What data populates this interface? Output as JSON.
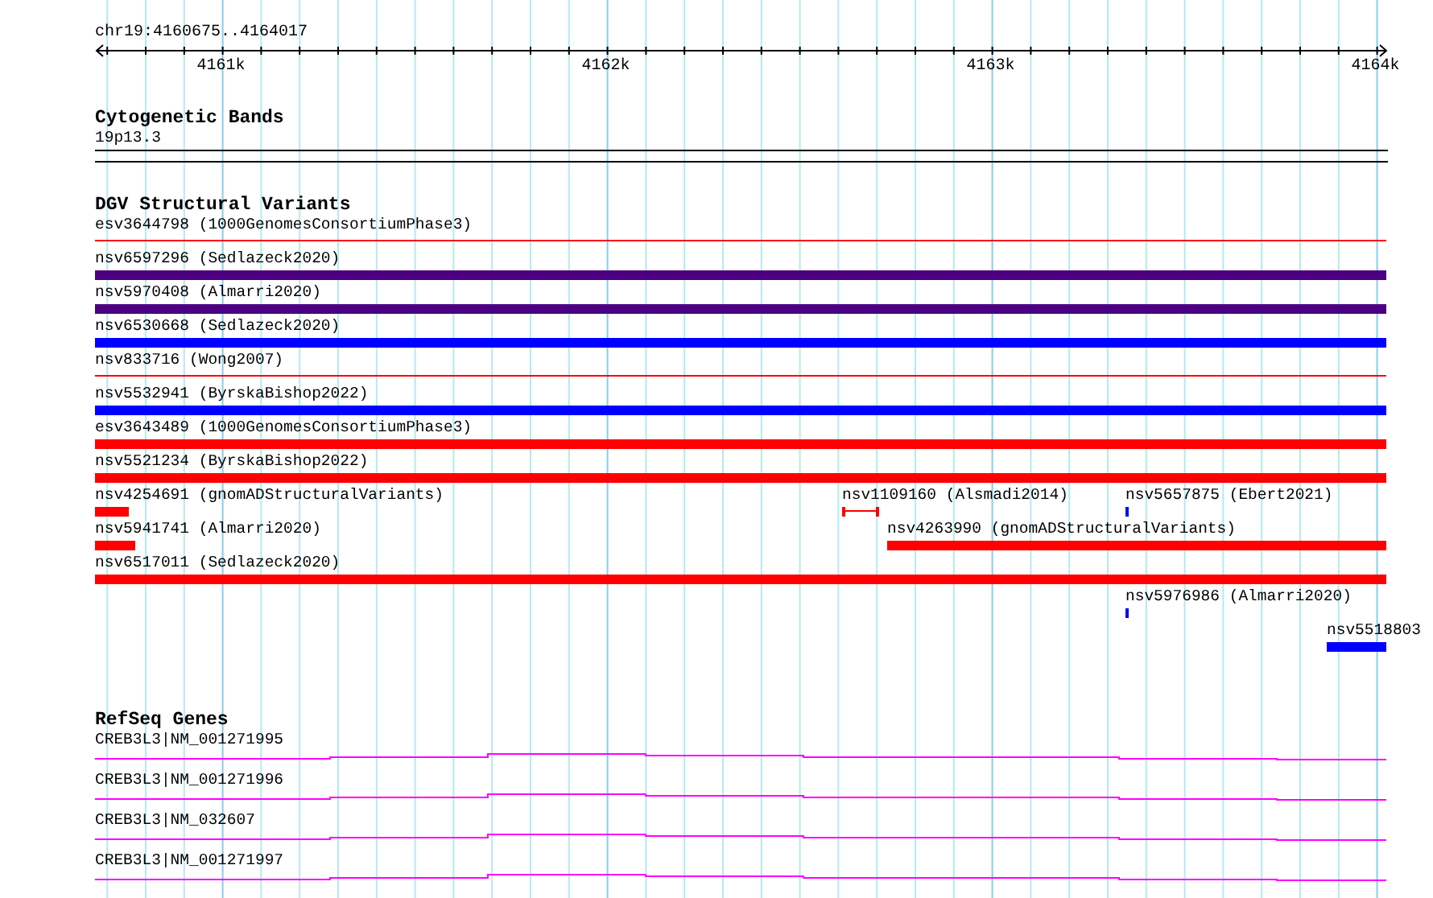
{
  "ruler": {
    "location": "chr19:4160675..4164017",
    "ticks": [
      "4161k",
      "4162k",
      "4163k",
      "4164k"
    ]
  },
  "cytogenetic_bands": {
    "title": "Cytogenetic Bands",
    "band": "19p13.3"
  },
  "dgv": {
    "title": "DGV Structural Variants",
    "lanes": [
      {
        "features": [
          {
            "label": "esv3644798 (1000GenomesConsortiumPhase3)",
            "kind": "line",
            "color": "#ff0000"
          }
        ]
      },
      {
        "features": [
          {
            "label": "nsv6597296 (Sedlazeck2020)",
            "kind": "bar",
            "color": "#4b0082"
          }
        ]
      },
      {
        "features": [
          {
            "label": "nsv5970408 (Almarri2020)",
            "kind": "bar",
            "color": "#4b0082"
          }
        ]
      },
      {
        "features": [
          {
            "label": "nsv6530668 (Sedlazeck2020)",
            "kind": "bar",
            "color": "#0000ff"
          }
        ]
      },
      {
        "features": [
          {
            "label": "nsv833716 (Wong2007)",
            "kind": "line",
            "color": "#ff0000"
          }
        ]
      },
      {
        "features": [
          {
            "label": "nsv5532941 (ByrskaBishop2022)",
            "kind": "bar",
            "color": "#0000ff"
          }
        ]
      },
      {
        "features": [
          {
            "label": "esv3643489 (1000GenomesConsortiumPhase3)",
            "kind": "bar",
            "color": "#ff0000"
          }
        ]
      },
      {
        "features": [
          {
            "label": "nsv5521234 (ByrskaBishop2022)",
            "kind": "bar",
            "color": "#ff0000"
          }
        ]
      },
      {
        "features": [
          {
            "label": "nsv4254691 (gnomADStructuralVariants)",
            "kind": "bar",
            "color": "#ff0000"
          },
          {
            "label": "nsv1109160 (Alsmadi2014)",
            "kind": "bracket",
            "color": "#ff0000"
          },
          {
            "label": "nsv5657875 (Ebert2021)",
            "kind": "bar",
            "color": "#0000ff"
          }
        ]
      },
      {
        "features": [
          {
            "label": "nsv5941741 (Almarri2020)",
            "kind": "bar",
            "color": "#ff0000"
          },
          {
            "label": "nsv4263990 (gnomADStructuralVariants)",
            "kind": "bar",
            "color": "#ff0000"
          }
        ]
      },
      {
        "features": [
          {
            "label": "nsv6517011 (Sedlazeck2020)",
            "kind": "bar",
            "color": "#ff0000"
          }
        ]
      },
      {
        "features": [
          {
            "label": "nsv5976986 (Almarri2020)",
            "kind": "bar",
            "color": "#0000ff"
          }
        ]
      },
      {
        "features": [
          {
            "label": "nsv5518803",
            "kind": "bar",
            "color": "#0000ff"
          }
        ]
      }
    ]
  },
  "refseq_genes": {
    "title": "RefSeq Genes",
    "genes": [
      {
        "label": "CREB3L3|NM_001271995"
      },
      {
        "label": "CREB3L3|NM_001271996"
      },
      {
        "label": "CREB3L3|NM_032607"
      },
      {
        "label": "CREB3L3|NM_001271997"
      }
    ]
  }
}
